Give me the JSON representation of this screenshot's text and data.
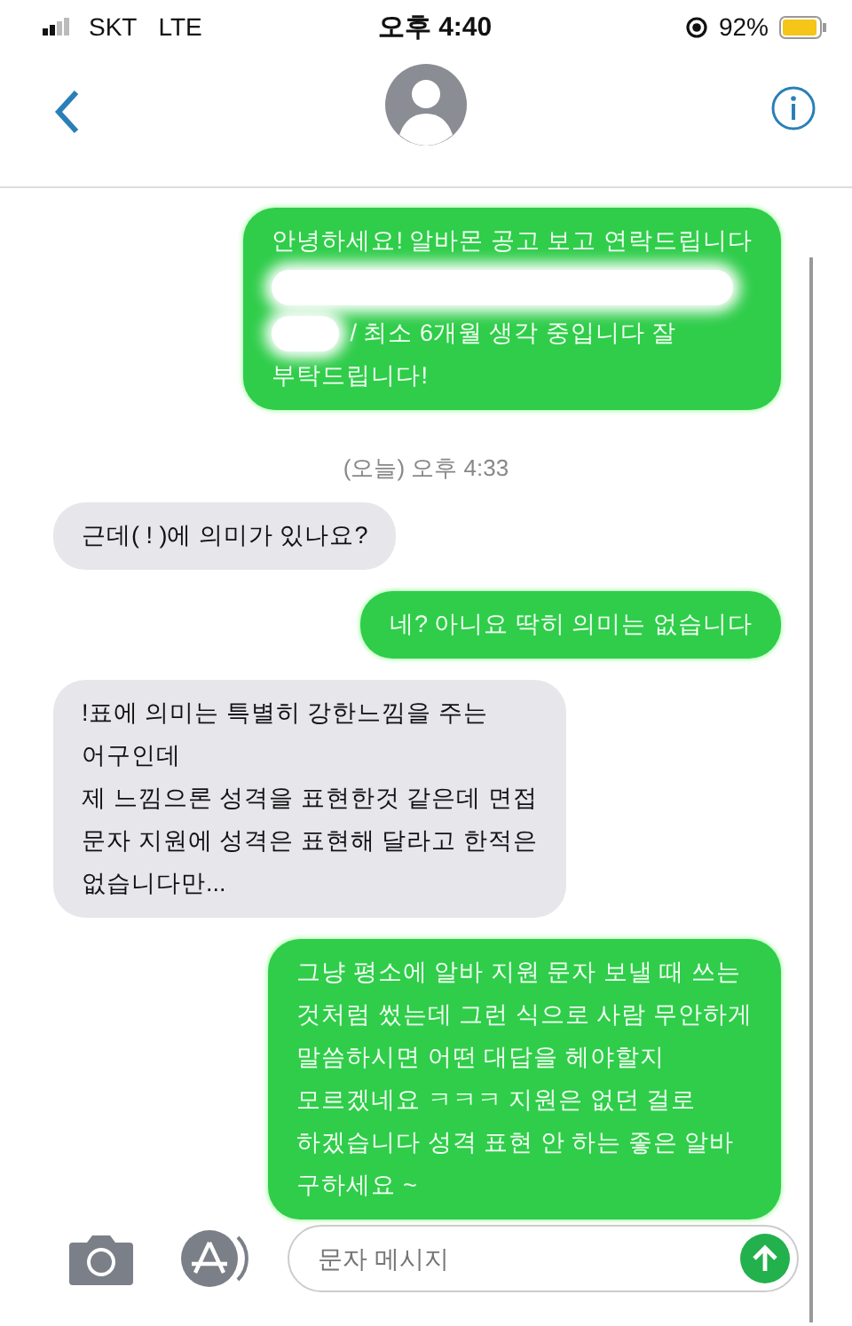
{
  "status_bar": {
    "carrier": "SKT",
    "network": "LTE",
    "time": "오후 4:40",
    "battery": "92%"
  },
  "messages": [
    {
      "kind": "sent",
      "lines": [
        [
          {
            "kind": "text",
            "text": "안녕하세요! 알바몬 공고 보고 연락드립니다"
          }
        ],
        [
          {
            "kind": "redaction_line"
          }
        ],
        [
          {
            "kind": "redaction_inline"
          },
          {
            "kind": "text",
            "text": "/ 최소 6개월 생각 중입니다 잘"
          }
        ],
        [
          {
            "kind": "text",
            "text": "부탁드립니다!"
          }
        ]
      ]
    },
    {
      "kind": "timestamp",
      "text": "(오늘) 오후 4:33"
    },
    {
      "kind": "received",
      "text": "근데( ! )에 의미가 있나요?"
    },
    {
      "kind": "sent",
      "text": "네? 아니요 딱히 의미는 없습니다"
    },
    {
      "kind": "received",
      "text": "!표에 의미는 특별히 강한느낌을 주는\n어구인데\n제 느낌으론 성격을 표현한것 같은데 면접\n문자 지원에 성격은 표현해 달라고 한적은\n없습니다만..."
    },
    {
      "kind": "sent",
      "text": "그냥 평소에 알바 지원 문자 보낼 때 쓰는\n것처럼 썼는데 그런 식으로 사람 무안하게\n말씀하시면 어떤 대답을 헤야할지\n모르겠네요 ㅋㅋㅋ 지원은 없던 걸로\n하겠습니다 성격 표현 안 하는 좋은 알바\n구하세요 ~"
    }
  ],
  "composer": {
    "placeholder": "문자 메시지"
  }
}
